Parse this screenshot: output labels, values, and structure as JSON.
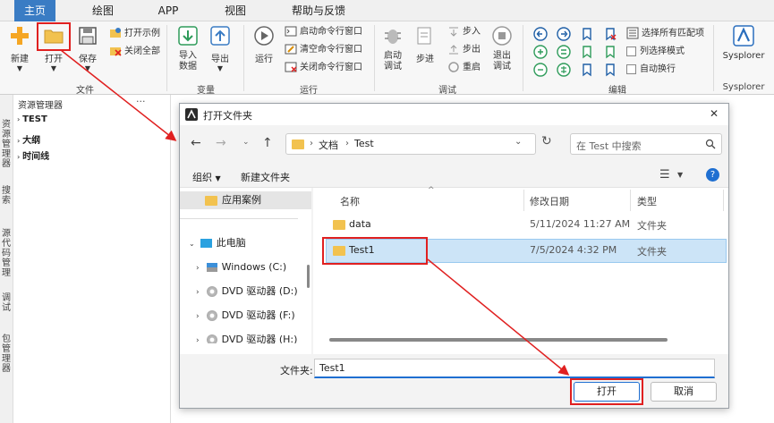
{
  "tabs": [
    "主页",
    "绘图",
    "APP",
    "视图",
    "帮助与反馈"
  ],
  "ribbon": {
    "new_label": "新建",
    "open_label": "打开",
    "save_label": "保存",
    "open_examples": "打开示例",
    "close_all": "关闭全部",
    "group_file": "文件",
    "import_data": "导入数据",
    "export_label": "导出",
    "group_variables": "变量",
    "run_label": "运行",
    "start_cmd": "启动命令行窗口",
    "clear_cmd": "清空命令行窗口",
    "close_cmd": "关闭命令行窗口",
    "group_run": "运行",
    "start_debug": "启动调试",
    "step_label": "步进",
    "step_in": "步入",
    "step_out": "步出",
    "restart": "重启",
    "exit_debug": "退出调试",
    "group_debug": "调试",
    "select_all_matches": "选择所有匹配项",
    "column_select": "列选择模式",
    "auto_wrap": "自动换行",
    "group_edit": "编辑",
    "sysplorer_label": "Sysplorer",
    "group_sysplorer": "Sysplorer"
  },
  "left_strip": [
    "资源管理器",
    "搜索",
    "源代码管理",
    "调试",
    "包管理器"
  ],
  "explorer": {
    "title": "资源管理器",
    "more": "···",
    "rows": [
      "TEST",
      "大纲",
      "时间线"
    ]
  },
  "dialog": {
    "title": "打开文件夹",
    "close": "✕",
    "breadcrumb": [
      "文档",
      "Test"
    ],
    "search_placeholder": "在 Test 中搜索",
    "organize": "组织",
    "new_folder": "新建文件夹",
    "help": "?",
    "sidebar": {
      "quick": "应用案例",
      "this_pc": "此电脑",
      "drives": [
        "Windows (C:)",
        "DVD 驱动器 (D:)",
        "DVD 驱动器 (F:)",
        "DVD 驱动器 (H:)"
      ]
    },
    "columns": [
      "名称",
      "修改日期",
      "类型"
    ],
    "rows": [
      {
        "name": "data",
        "date": "5/11/2024 11:27 AM",
        "type": "文件夹"
      },
      {
        "name": "Test1",
        "date": "7/5/2024 4:32 PM",
        "type": "文件夹"
      }
    ],
    "folder_label": "文件夹:",
    "folder_value": "Test1",
    "open_button": "打开",
    "cancel_button": "取消"
  },
  "colors": {
    "accent": "#3a7cc4",
    "annotation": "#e02020",
    "selected_row": "#cce4f7"
  }
}
